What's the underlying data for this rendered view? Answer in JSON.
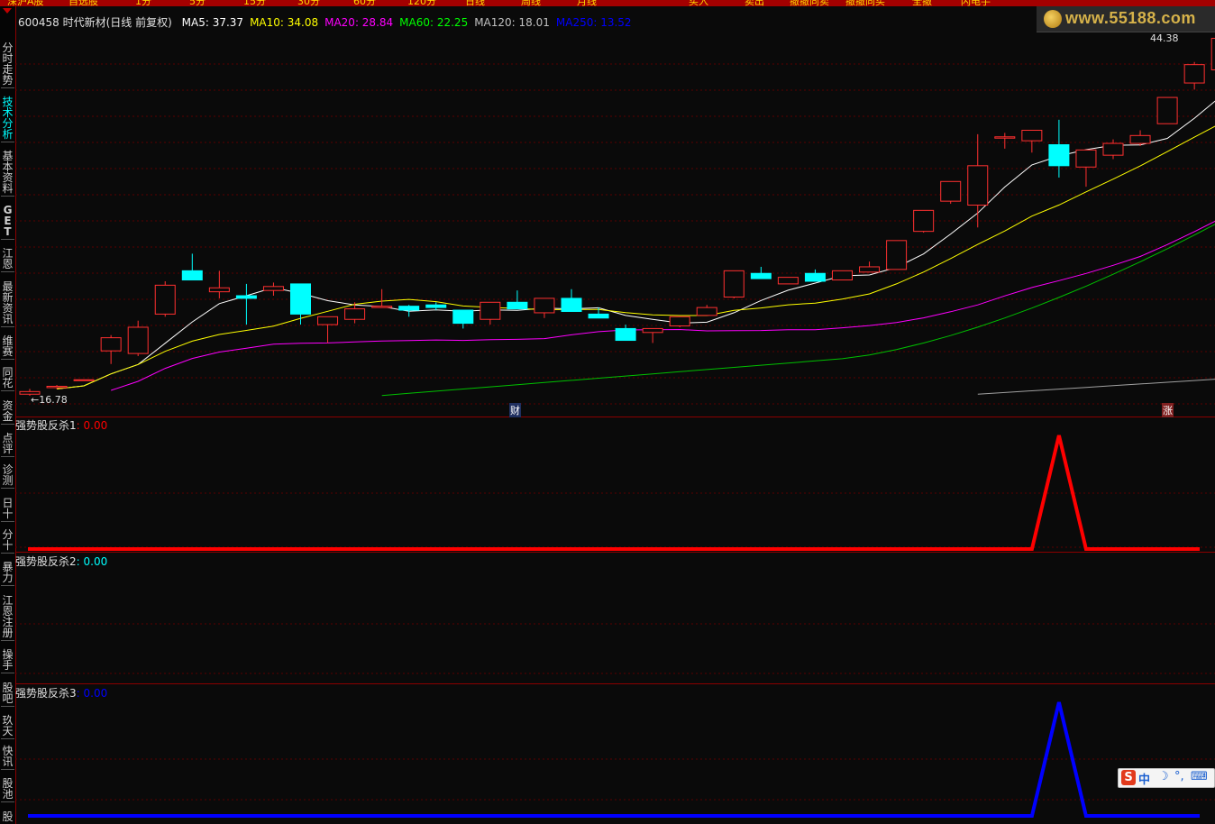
{
  "toolbar": {
    "items": [
      "深沪A股",
      "自选股",
      "1分",
      "5分",
      "15分",
      "30分",
      "60分",
      "120分",
      "日线",
      "周线",
      "月线",
      "买入",
      "卖出",
      "撤撤同卖",
      "撤撤同买",
      "全撤",
      "闪电手"
    ]
  },
  "sidebar": {
    "items": [
      "分时走势",
      "技术分析",
      "基本资料",
      "GET",
      "江恩",
      "最新资讯",
      "维赛",
      "同花",
      "资金",
      "点评",
      "诊测",
      "日十",
      "分十",
      "暴力",
      "江恩注册",
      "操手",
      "股吧",
      "玖天",
      "快讯",
      "股池",
      "股"
    ]
  },
  "stock": {
    "header": "600458 时代新材(日线 前复权)",
    "ma_labels": [
      {
        "text": "MA5: 37.37",
        "color": "#ffffff"
      },
      {
        "text": "MA10: 34.08",
        "color": "#ffff00"
      },
      {
        "text": "MA20: 28.84",
        "color": "#ff00ff"
      },
      {
        "text": "MA60: 22.25",
        "color": "#00ff00"
      },
      {
        "text": "MA120: 18.01",
        "color": "#c0c0c0"
      },
      {
        "text": "MA250: 13.52",
        "color": "#0000ff"
      }
    ],
    "high_label": "44.38",
    "low_label": "16.78",
    "markers": [
      {
        "text": "财"
      },
      {
        "text": "涨"
      }
    ]
  },
  "indicators": [
    {
      "title": "强势股反杀1",
      "value": ": 0.00",
      "color": "#ff0000"
    },
    {
      "title": "强势股反杀2",
      "value": ": 0.00",
      "color": "#00ffff"
    },
    {
      "title": "强势股反杀3",
      "value": ": 0.00",
      "color": "#0000ff"
    }
  ],
  "watermark": {
    "text": "www.55188.com"
  },
  "ime": {
    "s": "S",
    "mode": "中"
  },
  "chart_data": {
    "type": "candlestick",
    "ohlc": [
      [
        16.9,
        17.3,
        16.78,
        17.1
      ],
      [
        17.4,
        17.6,
        17.3,
        17.5
      ],
      [
        18.0,
        18.0,
        18.0,
        18.0
      ],
      [
        20.2,
        21.4,
        19.2,
        21.2
      ],
      [
        20.0,
        22.5,
        19.8,
        22.0
      ],
      [
        23.0,
        25.5,
        22.8,
        25.2
      ],
      [
        26.3,
        27.6,
        25.8,
        25.6
      ],
      [
        24.7,
        26.3,
        24.2,
        25.0
      ],
      [
        24.4,
        25.3,
        22.2,
        24.2
      ],
      [
        24.8,
        25.4,
        24.4,
        25.1
      ],
      [
        25.3,
        25.3,
        22.2,
        23.0
      ],
      [
        22.2,
        22.6,
        20.8,
        22.8
      ],
      [
        22.6,
        23.9,
        22.3,
        23.4
      ],
      [
        23.5,
        24.9,
        23.5,
        23.6
      ],
      [
        23.6,
        23.7,
        22.8,
        23.3
      ],
      [
        23.7,
        23.9,
        23.3,
        23.5
      ],
      [
        23.3,
        23.3,
        21.9,
        22.3
      ],
      [
        22.6,
        22.6,
        22.2,
        23.9
      ],
      [
        23.9,
        24.8,
        23.9,
        23.4
      ],
      [
        23.1,
        24.1,
        22.7,
        24.2
      ],
      [
        24.2,
        24.9,
        24.2,
        23.2
      ],
      [
        23.0,
        23.5,
        22.8,
        22.7
      ],
      [
        21.9,
        22.2,
        21.0,
        21.0
      ],
      [
        21.6,
        21.9,
        20.8,
        21.9
      ],
      [
        22.1,
        22.8,
        22.0,
        22.8
      ],
      [
        22.9,
        23.7,
        22.9,
        23.5
      ],
      [
        24.3,
        24.6,
        24.2,
        26.3
      ],
      [
        26.1,
        26.6,
        26.1,
        25.7
      ],
      [
        25.3,
        25.4,
        25.3,
        25.8
      ],
      [
        26.1,
        26.4,
        26.1,
        25.5
      ],
      [
        25.6,
        26.1,
        25.6,
        26.3
      ],
      [
        26.2,
        27.0,
        26.2,
        26.6
      ],
      [
        26.4,
        26.6,
        26.4,
        28.6
      ],
      [
        29.3,
        30.0,
        29.2,
        30.9
      ],
      [
        31.6,
        32.1,
        31.4,
        33.1
      ],
      [
        31.3,
        36.7,
        29.6,
        34.3
      ],
      [
        36.4,
        36.8,
        35.6,
        36.5
      ],
      [
        36.2,
        36.5,
        35.3,
        37.0
      ],
      [
        35.9,
        37.8,
        33.4,
        34.3
      ],
      [
        34.2,
        35.2,
        32.7,
        35.5
      ],
      [
        35.1,
        36.3,
        34.8,
        36.0
      ],
      [
        36.0,
        37.0,
        35.8,
        36.6
      ],
      [
        37.5,
        38.2,
        37.6,
        39.5
      ],
      [
        40.6,
        42.2,
        40.1,
        42.0
      ],
      [
        41.6,
        44.38,
        40.2,
        44.0
      ]
    ],
    "indicator_1": {
      "name": "强势股反杀1",
      "baseline": 0,
      "peak_index": 38
    },
    "indicator_3": {
      "name": "强势股反杀3",
      "baseline": 0,
      "peak_index": 38
    }
  }
}
